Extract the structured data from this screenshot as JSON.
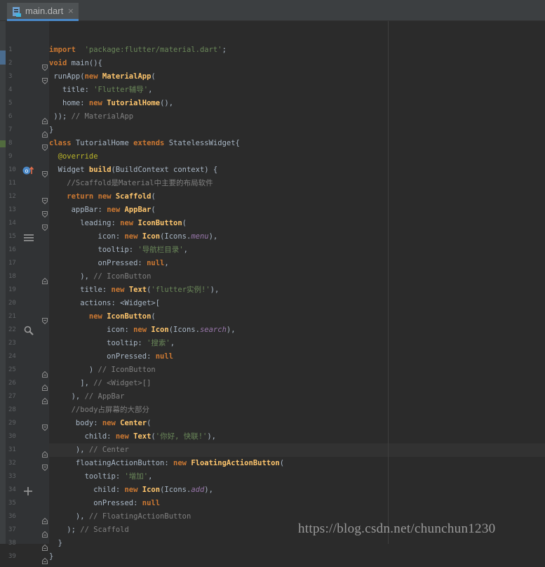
{
  "tab": {
    "filename": "main.dart",
    "close_glyph": "×"
  },
  "watermark": "https://blog.csdn.net/chunchun1230",
  "gutter_icons": [
    {
      "line": 10,
      "icon": "override-method-icon"
    },
    {
      "line": 15,
      "icon": "menu-icon"
    },
    {
      "line": 22,
      "icon": "search-icon"
    },
    {
      "line": 34,
      "icon": "add-icon"
    }
  ],
  "lines": [
    {
      "n": "1",
      "tokens": [
        [
          "kw",
          "import"
        ],
        [
          "",
          "  "
        ],
        [
          "str",
          "'package:flutter/material.dart'"
        ],
        [
          "",
          ";"
        ]
      ]
    },
    {
      "n": "2",
      "tokens": [
        [
          "kw",
          "void"
        ],
        [
          "",
          " main(){"
        ]
      ]
    },
    {
      "n": "3",
      "tokens": [
        [
          "",
          " runApp("
        ],
        [
          "kw",
          "new"
        ],
        [
          "",
          " "
        ],
        [
          "cls",
          "MaterialApp"
        ],
        [
          "",
          "("
        ]
      ]
    },
    {
      "n": "4",
      "tokens": [
        [
          "",
          "   title: "
        ],
        [
          "str",
          "'Flutter辅导'"
        ],
        [
          "",
          ","
        ]
      ]
    },
    {
      "n": "5",
      "tokens": [
        [
          "",
          "   home: "
        ],
        [
          "kw",
          "new"
        ],
        [
          "",
          " "
        ],
        [
          "cls",
          "TutorialHome"
        ],
        [
          "",
          "(),"
        ]
      ]
    },
    {
      "n": "6",
      "tokens": [
        [
          "",
          " )); "
        ],
        [
          "cmt",
          "// MaterialApp"
        ]
      ]
    },
    {
      "n": "7",
      "tokens": [
        [
          "",
          "}"
        ]
      ]
    },
    {
      "n": "8",
      "tokens": [
        [
          "kw",
          "class"
        ],
        [
          "",
          " TutorialHome "
        ],
        [
          "kw",
          "extends"
        ],
        [
          "",
          " StatelessWidget{"
        ]
      ]
    },
    {
      "n": "9",
      "tokens": [
        [
          "ann",
          "  @override"
        ]
      ]
    },
    {
      "n": "10",
      "tokens": [
        [
          "",
          "  Widget "
        ],
        [
          "cls",
          "build"
        ],
        [
          "",
          "(BuildContext context) {"
        ]
      ]
    },
    {
      "n": "11",
      "tokens": [
        [
          "cmt",
          "    //Scaffold是Material中主要的布局软件"
        ]
      ]
    },
    {
      "n": "12",
      "tokens": [
        [
          "",
          "    "
        ],
        [
          "kw",
          "return"
        ],
        [
          "",
          " "
        ],
        [
          "kw",
          "new"
        ],
        [
          "",
          " "
        ],
        [
          "cls",
          "Scaffold"
        ],
        [
          "",
          "("
        ]
      ]
    },
    {
      "n": "13",
      "tokens": [
        [
          "",
          "     appBar: "
        ],
        [
          "kw",
          "new"
        ],
        [
          "",
          " "
        ],
        [
          "cls",
          "AppBar"
        ],
        [
          "",
          "("
        ]
      ]
    },
    {
      "n": "14",
      "tokens": [
        [
          "",
          "       leading: "
        ],
        [
          "kw",
          "new"
        ],
        [
          "",
          " "
        ],
        [
          "cls",
          "IconButton"
        ],
        [
          "",
          "("
        ]
      ]
    },
    {
      "n": "15",
      "tokens": [
        [
          "",
          "           icon: "
        ],
        [
          "kw",
          "new"
        ],
        [
          "",
          " "
        ],
        [
          "cls",
          "Icon"
        ],
        [
          "",
          "(Icons."
        ],
        [
          "prop",
          "menu"
        ],
        [
          "",
          "),"
        ]
      ]
    },
    {
      "n": "16",
      "tokens": [
        [
          "",
          "           tooltip: "
        ],
        [
          "str",
          "'导航栏目录'"
        ],
        [
          "",
          ","
        ]
      ]
    },
    {
      "n": "17",
      "tokens": [
        [
          "",
          "           onPressed: "
        ],
        [
          "kw",
          "null"
        ],
        [
          "",
          ","
        ]
      ]
    },
    {
      "n": "18",
      "tokens": [
        [
          "",
          "       ), "
        ],
        [
          "cmt",
          "// IconButton"
        ]
      ]
    },
    {
      "n": "19",
      "tokens": [
        [
          "",
          "       title: "
        ],
        [
          "kw",
          "new"
        ],
        [
          "",
          " "
        ],
        [
          "cls",
          "Text"
        ],
        [
          "",
          "("
        ],
        [
          "str",
          "'flutter实例!'"
        ],
        [
          "",
          "),"
        ]
      ]
    },
    {
      "n": "20",
      "tokens": [
        [
          "",
          "       actions: <Widget>["
        ]
      ]
    },
    {
      "n": "21",
      "tokens": [
        [
          "",
          "         "
        ],
        [
          "kw",
          "new"
        ],
        [
          "",
          " "
        ],
        [
          "cls",
          "IconButton"
        ],
        [
          "",
          "("
        ]
      ]
    },
    {
      "n": "22",
      "tokens": [
        [
          "",
          "             icon: "
        ],
        [
          "kw",
          "new"
        ],
        [
          "",
          " "
        ],
        [
          "cls",
          "Icon"
        ],
        [
          "",
          "(Icons."
        ],
        [
          "prop",
          "search"
        ],
        [
          "",
          "),"
        ]
      ]
    },
    {
      "n": "23",
      "tokens": [
        [
          "",
          "             tooltip: "
        ],
        [
          "str",
          "'搜索'"
        ],
        [
          "",
          ","
        ]
      ]
    },
    {
      "n": "24",
      "tokens": [
        [
          "",
          "             onPressed: "
        ],
        [
          "kw",
          "null"
        ]
      ]
    },
    {
      "n": "25",
      "tokens": [
        [
          "",
          "         ) "
        ],
        [
          "cmt",
          "// IconButton"
        ]
      ]
    },
    {
      "n": "26",
      "tokens": [
        [
          "",
          "       ], "
        ],
        [
          "cmt",
          "// <Widget>[]"
        ]
      ]
    },
    {
      "n": "27",
      "tokens": [
        [
          "",
          "     ), "
        ],
        [
          "cmt",
          "// AppBar"
        ]
      ]
    },
    {
      "n": "28",
      "tokens": [
        [
          "cmt",
          "     //body占屏幕的大部分"
        ]
      ]
    },
    {
      "n": "29",
      "tokens": [
        [
          "",
          "      body: "
        ],
        [
          "kw",
          "new"
        ],
        [
          "",
          " "
        ],
        [
          "cls",
          "Center"
        ],
        [
          "",
          "("
        ]
      ]
    },
    {
      "n": "30",
      "tokens": [
        [
          "",
          "        child: "
        ],
        [
          "kw",
          "new"
        ],
        [
          "",
          " "
        ],
        [
          "cls",
          "Text"
        ],
        [
          "",
          "("
        ],
        [
          "str",
          "'你好, 快联!'"
        ],
        [
          "",
          "),"
        ]
      ]
    },
    {
      "n": "31",
      "tokens": [
        [
          "",
          "      ), "
        ],
        [
          "cmt",
          "// Center"
        ]
      ]
    },
    {
      "n": "32",
      "tokens": [
        [
          "",
          "      floatingActionButton: "
        ],
        [
          "kw",
          "new"
        ],
        [
          "",
          " "
        ],
        [
          "cls",
          "FloatingActionButton"
        ],
        [
          "",
          "("
        ]
      ]
    },
    {
      "n": "33",
      "tokens": [
        [
          "",
          "        tooltip: "
        ],
        [
          "str",
          "'增加'"
        ],
        [
          "",
          ","
        ]
      ]
    },
    {
      "n": "34",
      "tokens": [
        [
          "",
          "          child: "
        ],
        [
          "kw",
          "new"
        ],
        [
          "",
          " "
        ],
        [
          "cls",
          "Icon"
        ],
        [
          "",
          "(Icons."
        ],
        [
          "prop",
          "add"
        ],
        [
          "",
          "),"
        ]
      ]
    },
    {
      "n": "35",
      "tokens": [
        [
          "",
          "          onPressed: "
        ],
        [
          "kw",
          "null"
        ]
      ]
    },
    {
      "n": "36",
      "tokens": [
        [
          "",
          "      ), "
        ],
        [
          "cmt",
          "// FloatingActionButton"
        ]
      ]
    },
    {
      "n": "37",
      "tokens": [
        [
          "",
          "    ); "
        ],
        [
          "cmt",
          "// Scaffold"
        ]
      ]
    },
    {
      "n": "38",
      "tokens": [
        [
          "",
          "  }"
        ]
      ]
    },
    {
      "n": "39",
      "tokens": [
        [
          "",
          "}"
        ]
      ]
    }
  ]
}
